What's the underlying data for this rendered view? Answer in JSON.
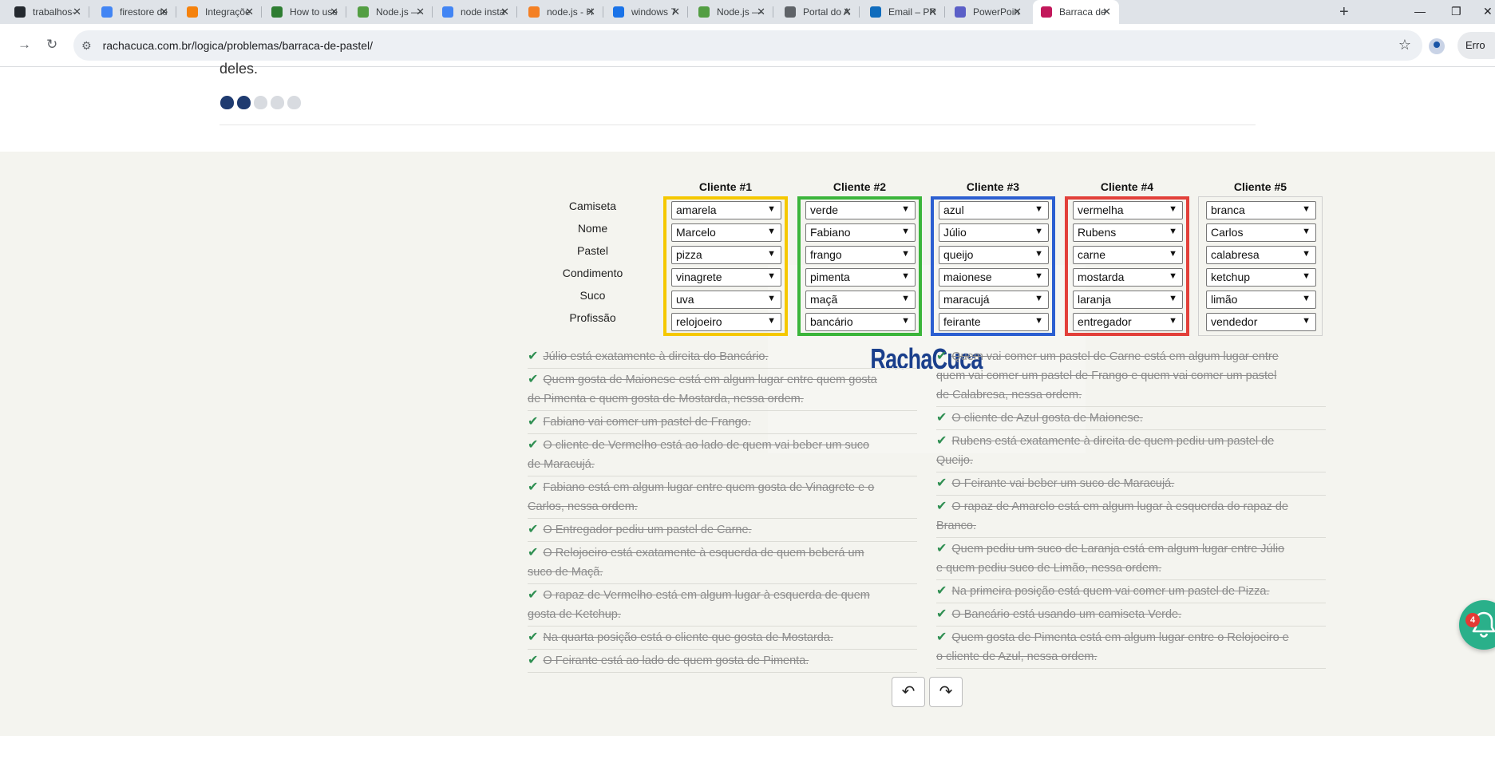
{
  "browser": {
    "tabs": [
      {
        "title": "trabalhos-",
        "icon": "github-icon",
        "color": "#24292f"
      },
      {
        "title": "firestore de",
        "icon": "google-icon",
        "color": "#4285f4"
      },
      {
        "title": "Integraçõe",
        "icon": "firebase-icon",
        "color": "#f5820d"
      },
      {
        "title": "How to use",
        "icon": "link-icon",
        "color": "#2e7d32"
      },
      {
        "title": "Node.js —",
        "icon": "nodejs-icon",
        "color": "#539e43"
      },
      {
        "title": "node insta",
        "icon": "google-icon",
        "color": "#4285f4"
      },
      {
        "title": "node.js - H",
        "icon": "stackoverflow-icon",
        "color": "#f48024"
      },
      {
        "title": "windows 7",
        "icon": "document-icon",
        "color": "#1a73e8"
      },
      {
        "title": "Node.js —",
        "icon": "nodejs-icon",
        "color": "#539e43"
      },
      {
        "title": "Portal do A",
        "icon": "globe-icon",
        "color": "#5f6368"
      },
      {
        "title": "Email – PR",
        "icon": "outlook-icon",
        "color": "#0f6cbd"
      },
      {
        "title": "PowerPoin",
        "icon": "teams-icon",
        "color": "#5b5fc7"
      },
      {
        "title": "Barraca de",
        "icon": "rachacuca-icon",
        "color": "#c2185b"
      }
    ],
    "url": "rachacuca.com.br/logica/problemas/barraca-de-pastel/",
    "profile_label": "Erro"
  },
  "page": {
    "intro_tail": "deles.",
    "difficulty": {
      "level": 2,
      "max": 5
    },
    "clientes": [
      {
        "header": "Cliente #1",
        "color": "#f5c800",
        "values": [
          "amarela",
          "Marcelo",
          "pizza",
          "vinagrete",
          "uva",
          "relojoeiro"
        ]
      },
      {
        "header": "Cliente #2",
        "color": "#3bb53b",
        "values": [
          "verde",
          "Fabiano",
          "frango",
          "pimenta",
          "maçã",
          "bancário"
        ]
      },
      {
        "header": "Cliente #3",
        "color": "#2c5fd1",
        "values": [
          "azul",
          "Júlio",
          "queijo",
          "maionese",
          "maracujá",
          "feirante"
        ]
      },
      {
        "header": "Cliente #4",
        "color": "#e2403a",
        "values": [
          "vermelha",
          "Rubens",
          "carne",
          "mostarda",
          "laranja",
          "entregador"
        ]
      },
      {
        "header": "Cliente #5",
        "color": "#cfcfcf",
        "values": [
          "branca",
          "Carlos",
          "calabresa",
          "ketchup",
          "limão",
          "vendedor"
        ]
      }
    ],
    "row_labels": [
      "Camiseta",
      "Nome",
      "Pastel",
      "Condimento",
      "Suco",
      "Profissão"
    ],
    "clues_left": [
      {
        "lines": [
          "Júlio está exatamente à direita do Bancário."
        ]
      },
      {
        "lines": [
          "Quem gosta de Maionese está em algum lugar entre quem gosta",
          "de Pimenta e quem gosta de Mostarda, nessa ordem."
        ]
      },
      {
        "lines": [
          "Fabiano vai comer um pastel de Frango."
        ]
      },
      {
        "lines": [
          "O cliente de Vermelho está ao lado de quem vai beber um suco",
          "de Maracujá."
        ]
      },
      {
        "lines": [
          "Fabiano está em algum lugar entre quem gosta de Vinagrete e o",
          "Carlos, nessa ordem."
        ]
      },
      {
        "lines": [
          "O Entregador pediu um pastel de Carne."
        ]
      },
      {
        "lines": [
          "O Relojoeiro está exatamente à esquerda de quem beberá um",
          "suco de Maçã."
        ]
      },
      {
        "lines": [
          "O rapaz de Vermelho está em algum lugar à esquerda de quem",
          "gosta de Ketchup."
        ]
      },
      {
        "lines": [
          "Na quarta posição está o cliente que gosta de Mostarda."
        ]
      },
      {
        "lines": [
          "O Feirante está ao lado de quem gosta de Pimenta."
        ]
      }
    ],
    "clues_right": [
      {
        "lines": [
          "Quem vai comer um pastel de Carne está em algum lugar entre",
          "quem vai comer um pastel de Frango e quem vai comer um pastel",
          "de Calabresa, nessa ordem."
        ]
      },
      {
        "lines": [
          "O cliente de Azul gosta de Maionese."
        ]
      },
      {
        "lines": [
          "Rubens está exatamente à direita de quem pediu um pastel de",
          "Queijo."
        ]
      },
      {
        "lines": [
          "O Feirante vai beber um suco de Maracujá."
        ]
      },
      {
        "lines": [
          "O rapaz de Amarelo está em algum lugar à esquerda do rapaz de",
          "Branco."
        ]
      },
      {
        "lines": [
          "Quem pediu um suco de Laranja está em algum lugar entre Júlio",
          "e quem pediu suco de Limão, nessa ordem."
        ]
      },
      {
        "lines": [
          "Na primeira posição está quem vai comer um pastel de Pizza."
        ]
      },
      {
        "lines": [
          "O Bancário está usando um camiseta Verde."
        ]
      },
      {
        "lines": [
          "Quem gosta de Pimenta está em algum lugar entre o Relojoeiro e",
          "o cliente de Azul, nessa ordem."
        ]
      }
    ],
    "logo_text": "RachaCuca",
    "controls": {
      "undo_icon": "undo-icon",
      "redo_icon": "redo-icon"
    },
    "notifications": {
      "count": "4"
    }
  }
}
